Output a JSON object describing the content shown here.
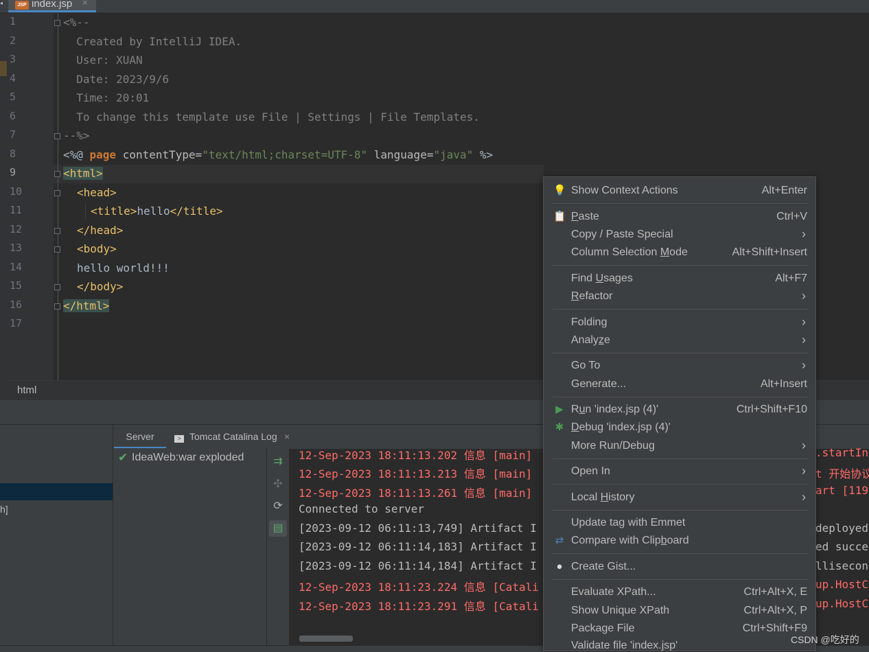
{
  "tab": {
    "icon_text": "JSP",
    "label": "index.jsp",
    "close": "×"
  },
  "editor": {
    "lines": [
      {
        "n": "1"
      },
      {
        "n": "2"
      },
      {
        "n": "3"
      },
      {
        "n": "4"
      },
      {
        "n": "5"
      },
      {
        "n": "6"
      },
      {
        "n": "7"
      },
      {
        "n": "8"
      },
      {
        "n": "9"
      },
      {
        "n": "10"
      },
      {
        "n": "11"
      },
      {
        "n": "12"
      },
      {
        "n": "13"
      },
      {
        "n": "14"
      },
      {
        "n": "15"
      },
      {
        "n": "16"
      },
      {
        "n": "17"
      }
    ],
    "code": {
      "l1": "<%--",
      "l2": "  Created by IntelliJ IDEA.",
      "l3": "  User: XUAN",
      "l4": "  Date: 2023/9/6",
      "l5": "  Time: 20:01",
      "l6": "  To change this template use File | Settings | File Templates.",
      "l7": "--%>",
      "l8_open": "<%@ ",
      "l8_kw": "page",
      "l8_a1": " contentType=",
      "l8_s1": "\"text/html;charset=UTF-8\"",
      "l8_a2": " language=",
      "l8_s2": "\"java\"",
      "l8_close": " %>",
      "l9": "<html>",
      "l10": "<head>",
      "l11_open": "<title>",
      "l11_text": "hello",
      "l11_close": "</title>",
      "l12": "</head>",
      "l13": "<body>",
      "l14": "hello world!!!",
      "l15": "</body>",
      "l16": "</html>"
    }
  },
  "breadcrumb": "html",
  "services": {
    "tabs": {
      "server": "Server",
      "tomcat": "Tomcat Catalina Log",
      "close": "×"
    },
    "left_fragment": "h]",
    "tree_item": "IdeaWeb:war exploded",
    "log": [
      {
        "text": "12-Sep-2023 18:11:13.202 信息 [main]",
        "tail": ".startIn",
        "kind": "red"
      },
      {
        "text": "12-Sep-2023 18:11:13.213 信息 [main]",
        "tail": "t 开始协议",
        "kind": "red"
      },
      {
        "text": "12-Sep-2023 18:11:13.261 信息 [main]",
        "tail": "art [119",
        "kind": "red"
      },
      {
        "text": "Connected to server",
        "tail": "",
        "kind": "gray"
      },
      {
        "text": "[2023-09-12 06:11:13,749] Artifact I",
        "tail": "deployed",
        "kind": "gray"
      },
      {
        "text": "[2023-09-12 06:11:14,183] Artifact I",
        "tail": "ed succe",
        "kind": "gray"
      },
      {
        "text": "[2023-09-12 06:11:14,184] Artifact I",
        "tail": "lliseconc",
        "kind": "gray"
      },
      {
        "text": "12-Sep-2023 18:11:23.224 信息 [Catali",
        "tail": "up.HostC",
        "kind": "red"
      },
      {
        "text": "12-Sep-2023 18:11:23.291 信息 [Catali",
        "tail": "up.HostC",
        "kind": "red"
      }
    ]
  },
  "menu": {
    "show_context_actions": {
      "label": "Show Context Actions",
      "shortcut": "Alt+Enter"
    },
    "paste": {
      "label": "Paste",
      "shortcut": "Ctrl+V"
    },
    "copy_paste_special": {
      "label": "Copy / Paste Special"
    },
    "column_selection": {
      "label": "Column Selection Mode",
      "shortcut": "Alt+Shift+Insert"
    },
    "find_usages": {
      "label": "Find Usages",
      "shortcut": "Alt+F7"
    },
    "refactor": {
      "label": "Refactor"
    },
    "folding": {
      "label": "Folding"
    },
    "analyze": {
      "label": "Analyze"
    },
    "go_to": {
      "label": "Go To"
    },
    "generate": {
      "label": "Generate...",
      "shortcut": "Alt+Insert"
    },
    "run": {
      "label": "Run 'index.jsp (4)'",
      "shortcut": "Ctrl+Shift+F10"
    },
    "debug": {
      "label": "Debug 'index.jsp (4)'"
    },
    "more_run_debug": {
      "label": "More Run/Debug"
    },
    "open_in": {
      "label": "Open In"
    },
    "local_history": {
      "label": "Local History"
    },
    "update_tag": {
      "label": "Update tag with Emmet"
    },
    "compare_clipboard": {
      "label": "Compare with Clipboard"
    },
    "create_gist": {
      "label": "Create Gist..."
    },
    "evaluate_xpath": {
      "label": "Evaluate XPath...",
      "shortcut": "Ctrl+Alt+X, E"
    },
    "show_unique_xpath": {
      "label": "Show Unique XPath",
      "shortcut": "Ctrl+Alt+X, P"
    },
    "package_file": {
      "label": "Package File",
      "shortcut": "Ctrl+Shift+F9"
    },
    "validate_file": {
      "label": "Validate file 'index.jsp'"
    }
  },
  "watermark": "CSDN @吃好的",
  "icons": {
    "bulb": "bulb-icon",
    "paste": "clipboard-icon",
    "run": "run-icon",
    "debug": "debug-icon",
    "compare": "compare-icon",
    "gist": "github-icon",
    "check": "check-icon"
  },
  "colors": {
    "accent": "#4a88c7",
    "run_green": "#499c54",
    "log_red": "#ff6b68",
    "tag_yellow": "#e8bf6a",
    "string_green": "#6a8759",
    "keyword_orange": "#cc7832"
  }
}
